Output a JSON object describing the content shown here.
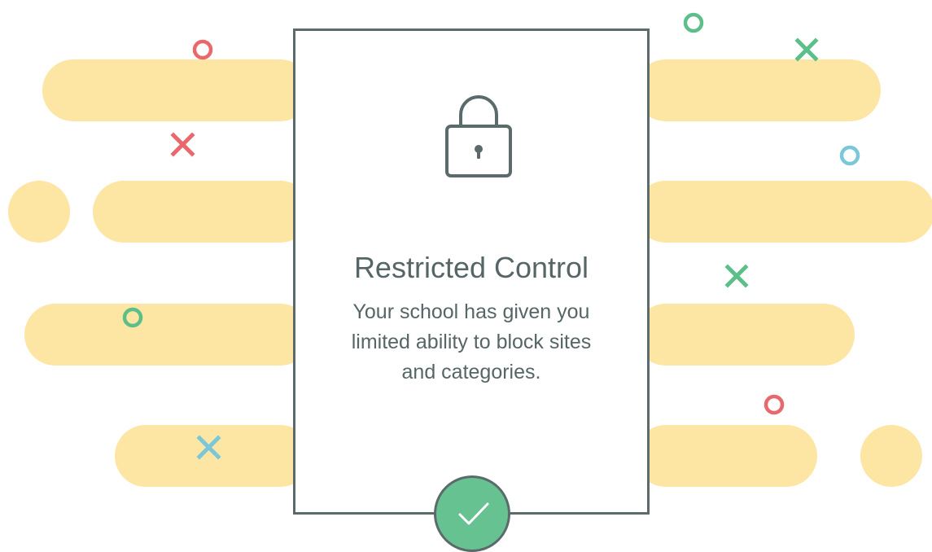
{
  "dialog": {
    "title": "Restricted Control",
    "message": "Your school has given you limited ability to block sites and categories.",
    "lock_icon": "lock-icon",
    "confirm_icon": "checkmark-icon"
  },
  "colors": {
    "background_pill": "#fde5a3",
    "card_border": "#5b6b6b",
    "text": "#566566",
    "confirm_button": "#66c291",
    "decor_red": "#e8686b",
    "decor_green": "#5cbf8a",
    "decor_blue": "#79c7d9"
  }
}
